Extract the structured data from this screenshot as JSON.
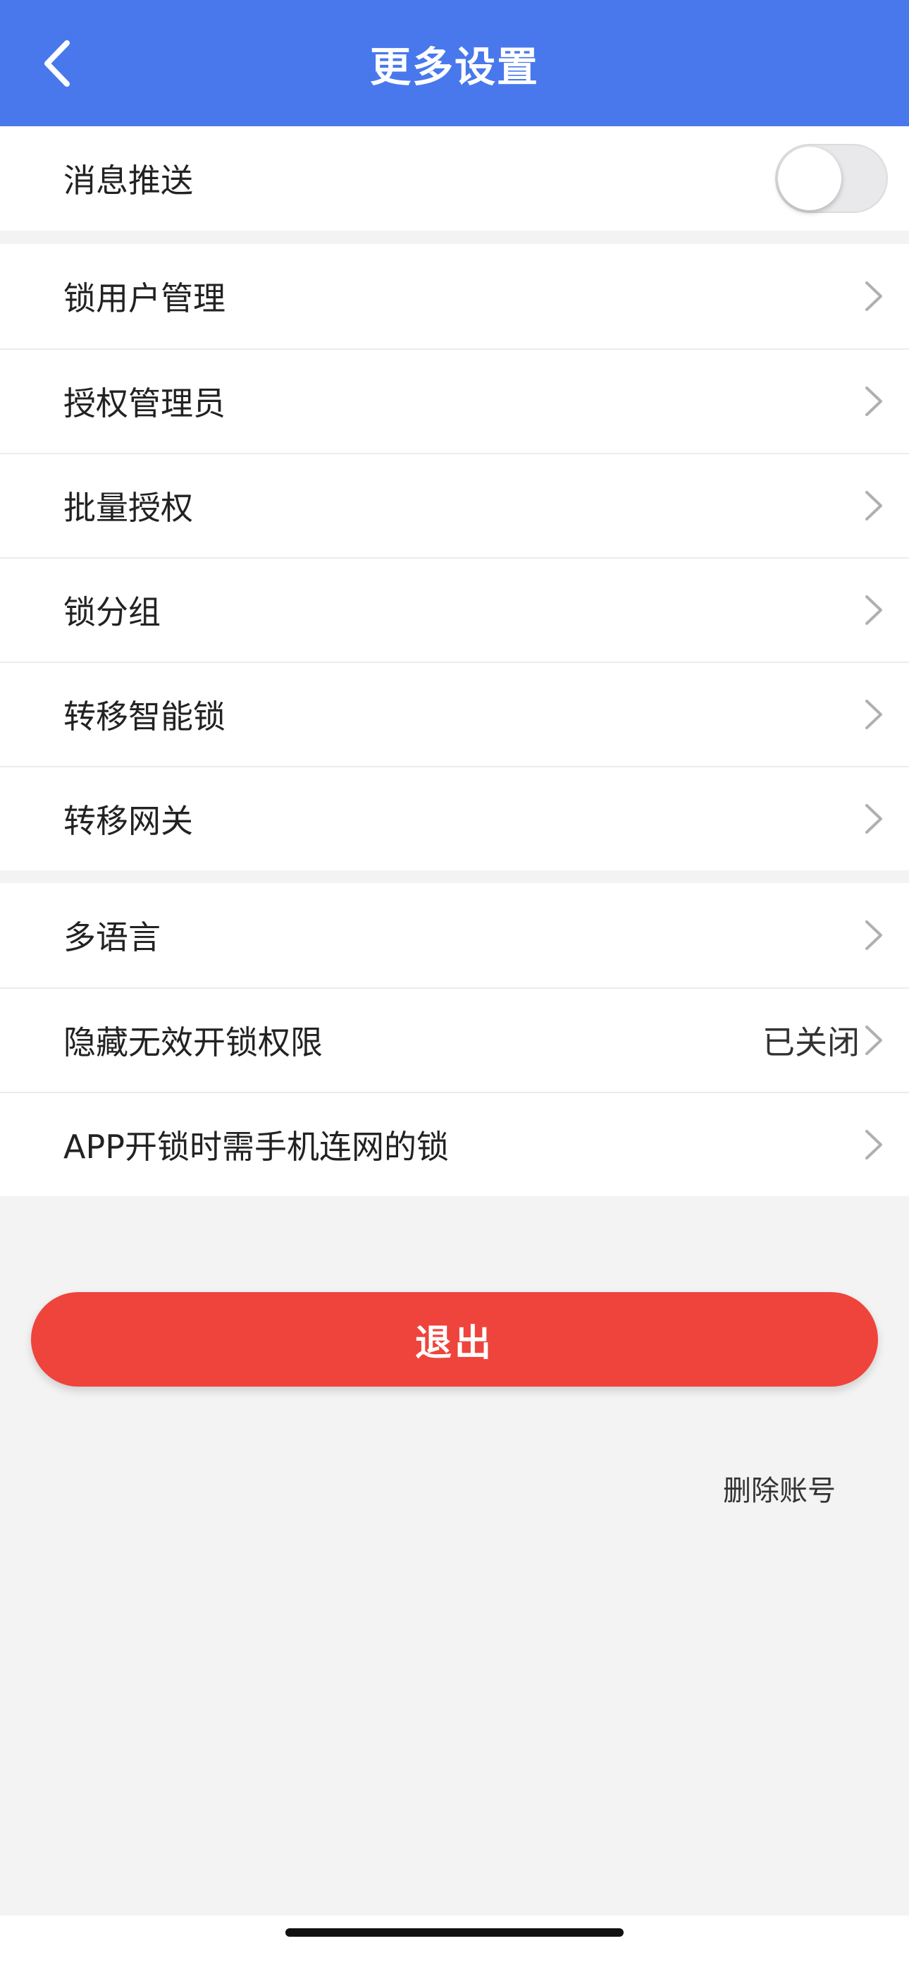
{
  "nav": {
    "title": "更多设置",
    "back_icon": "chevron-left-icon"
  },
  "colors": {
    "nav_background": "#4878ec",
    "logout_background": "#ee443b",
    "page_background": "#f3f3f3"
  },
  "push": {
    "label": "消息推送",
    "enabled": false
  },
  "group_locks": {
    "items": [
      {
        "label": "锁用户管理"
      },
      {
        "label": "授权管理员"
      },
      {
        "label": "批量授权"
      },
      {
        "label": "锁分组"
      },
      {
        "label": "转移智能锁"
      },
      {
        "label": "转移网关"
      }
    ]
  },
  "group_misc": {
    "language": {
      "label": "多语言"
    },
    "hide_invalid": {
      "label": "隐藏无效开锁权限",
      "value": "已关闭"
    },
    "app_unlock": {
      "label": "APP开锁时需手机连网的锁"
    }
  },
  "logout": {
    "label": "退出"
  },
  "delete_account": {
    "label": "删除账号"
  }
}
